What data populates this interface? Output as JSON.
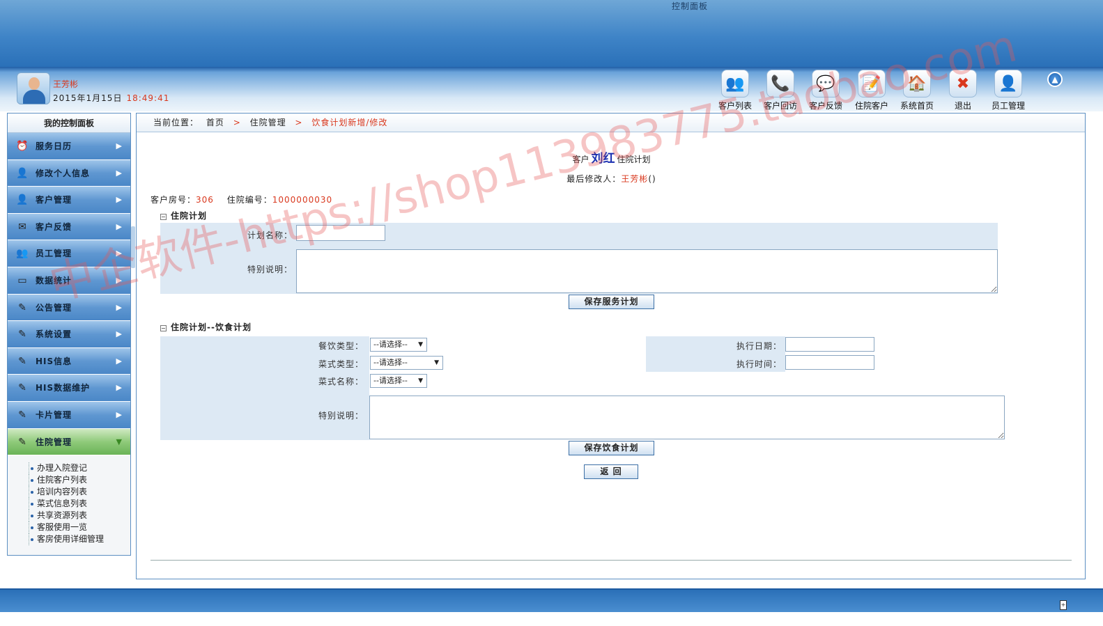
{
  "banner": {
    "title": "控制面板"
  },
  "user": {
    "name": "王芳彬",
    "date": "2015年1月15日",
    "time": "18:49:41"
  },
  "toolbar": {
    "items": [
      {
        "label": "客户列表",
        "icon": "customers-icon",
        "glyph": "👥"
      },
      {
        "label": "客户回访",
        "icon": "revisit-icon",
        "glyph": "📞"
      },
      {
        "label": "客户反馈",
        "icon": "feedback-icon",
        "glyph": "💬"
      },
      {
        "label": "住院客户",
        "icon": "inpatient-icon",
        "glyph": "📝"
      },
      {
        "label": "系统首页",
        "icon": "home-icon",
        "glyph": "🏠"
      },
      {
        "label": "退出",
        "icon": "exit-icon",
        "glyph": "✖"
      },
      {
        "label": "员工管理",
        "icon": "staff-icon",
        "glyph": "👤"
      }
    ]
  },
  "sidebar": {
    "title": "我的控制面板",
    "items": [
      {
        "label": "服务日历",
        "icon": "clock-icon",
        "glyph": "⏰"
      },
      {
        "label": "修改个人信息",
        "icon": "user-edit-icon",
        "glyph": "👤"
      },
      {
        "label": "客户管理",
        "icon": "customer-icon",
        "glyph": "👤"
      },
      {
        "label": "客户反馈",
        "icon": "feedback-icon",
        "glyph": "✉"
      },
      {
        "label": "员工管理",
        "icon": "staff-icon",
        "glyph": "👥"
      },
      {
        "label": "数据统计",
        "icon": "stats-icon",
        "glyph": "▭"
      },
      {
        "label": "公告管理",
        "icon": "notice-icon",
        "glyph": "✎"
      },
      {
        "label": "系统设置",
        "icon": "settings-icon",
        "glyph": "✎"
      },
      {
        "label": "HIS信息",
        "icon": "his-icon",
        "glyph": "✎"
      },
      {
        "label": "HIS数据维护",
        "icon": "his-maintain-icon",
        "glyph": "✎"
      },
      {
        "label": "卡片管理",
        "icon": "card-icon",
        "glyph": "✎"
      },
      {
        "label": "住院管理",
        "icon": "hospital-icon",
        "glyph": "✎"
      }
    ],
    "subitems": [
      "办理入院登记",
      "住院客户列表",
      "培训内容列表",
      "菜式信息列表",
      "共享资源列表",
      "客服使用一览",
      "客房使用详细管理"
    ]
  },
  "breadcrumb": {
    "prefix": "当前位置：",
    "home": "首页",
    "section": "住院管理",
    "current": "饮食计划新增/修改"
  },
  "heading": {
    "pre": "客户",
    "customer": "刘红",
    "post": "住院计划"
  },
  "modifier": {
    "label": "最后修改人：",
    "name": "王芳彬",
    "suffix": "()"
  },
  "room": {
    "room_label": "客户房号：",
    "room_no": "306",
    "admission_label": "住院编号：",
    "admission_no": "1000000030"
  },
  "plan_section": {
    "title": "住院计划",
    "name_label": "计划名称：",
    "name_value": "",
    "note_label": "特别说明：",
    "note_value": "",
    "save_label": "保存服务计划"
  },
  "diet_section": {
    "title": "住院计划--饮食计划",
    "meal_type_label": "餐饮类型：",
    "meal_type_value": "--请选择--",
    "dish_type_label": "菜式类型：",
    "dish_type_value": "--请选择--",
    "dish_name_label": "菜式名称：",
    "dish_name_value": "--请选择--",
    "exec_date_label": "执行日期：",
    "exec_date_value": "",
    "exec_time_label": "执行时间：",
    "exec_time_value": "",
    "note_label": "特别说明：",
    "note_value": "",
    "save_label": "保存饮食计划",
    "back_label": "返 回"
  },
  "watermark": {
    "text": "中企软件-https://shop113983775.taobao.com"
  },
  "colors": {
    "accent": "#2a70b8",
    "highlight": "#d9381e",
    "customer_name": "#1a2fb0",
    "panel": "#dde9f4"
  }
}
